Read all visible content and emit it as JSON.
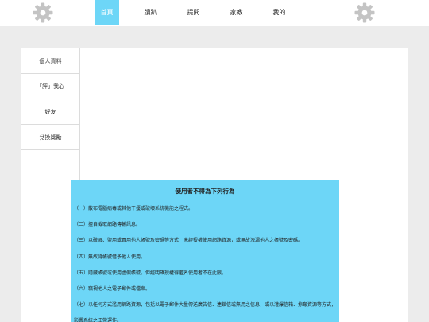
{
  "nav": {
    "items": [
      {
        "label": "首頁",
        "active": true
      },
      {
        "label": "牘趴",
        "active": false
      },
      {
        "label": "提問",
        "active": false
      },
      {
        "label": "家教",
        "active": false
      },
      {
        "label": "我的",
        "active": false
      }
    ]
  },
  "icons": {
    "left": "gear-icon",
    "right": "gear-icon"
  },
  "colors": {
    "accent": "#6dd6f7",
    "gear": "#c4c4c4",
    "background": "#ececec"
  },
  "sidebar": {
    "items": [
      {
        "label": "個人資料"
      },
      {
        "label": "「評」我心"
      },
      {
        "label": "好友"
      },
      {
        "label": "兌換獎勵"
      }
    ]
  },
  "modal": {
    "title": "使用者不得為下列行為",
    "rules": [
      "（一）散布電腦病毒或其他干擾或破壞系統機能之程式。",
      "（二）擅自截取網路傳輸訊息。",
      "（三）以破解、盜用或冒用他人帳號及密碼等方式，未經授權使用網路資源，或無故洩漏他人之帳號及密碼。",
      "（四）無故將帳號借予他人使用。",
      "（五）隱藏帳號或使用虛假帳號。但經明確授權得匿名使用者不在此限。",
      "（六）竊視他人之電子郵件或檔案。",
      "（七）以任何方式濫用網路資源，包括以電子郵件大量傳送廣告信、連鎖信或無用之信息，或以灌爆信箱、掠奪資源等方式，影響系統之正常運作。"
    ]
  }
}
